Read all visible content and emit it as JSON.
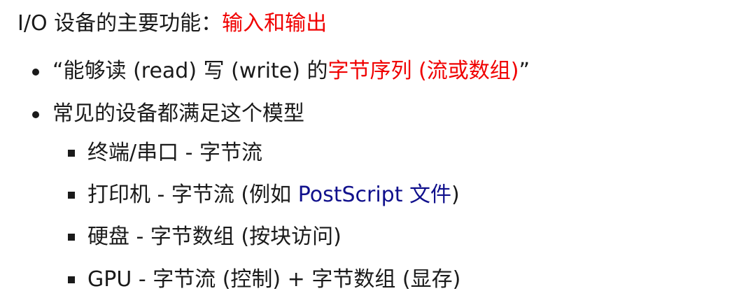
{
  "heading": {
    "prefix": "I/O 设备的主要功能：",
    "highlight": "输入和输出"
  },
  "bullets": [
    {
      "open_quote": "“",
      "text_a": "能够读 (read) 写 (write) 的",
      "highlight": "字节序列 (流或数组)",
      "close_quote": "”"
    },
    {
      "text": "常见的设备都满足这个模型"
    }
  ],
  "sub_bullets": [
    {
      "text": "终端/串口 - 字节流"
    },
    {
      "text_a": "打印机 - 字节流 (例如 ",
      "link": "PostScript 文件",
      "text_b": ")"
    },
    {
      "text": "硬盘 - 字节数组 (按块访问)"
    },
    {
      "text": "GPU - 字节流 (控制) + 字节数组 (显存)"
    }
  ],
  "colors": {
    "highlight": "#f00000",
    "link": "#10108c",
    "text": "#1a1a1a"
  }
}
